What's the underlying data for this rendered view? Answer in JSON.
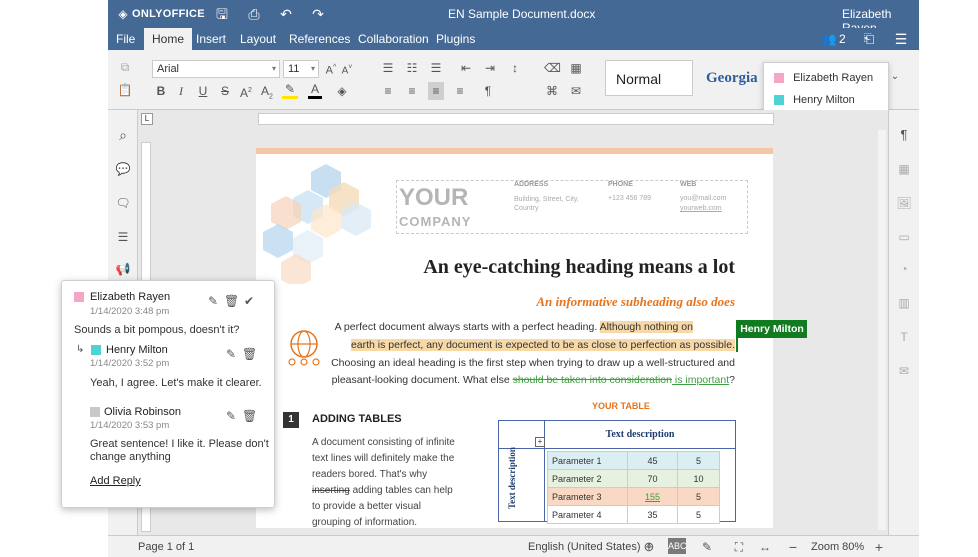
{
  "app": {
    "logo": "ONLYOFFICE",
    "doc_title": "EN Sample Document.docx",
    "user": "Elizabeth Rayen"
  },
  "menu": {
    "tabs": [
      "File",
      "Home",
      "Insert",
      "Layout",
      "References",
      "Collaboration",
      "Plugins"
    ],
    "active": "Home",
    "users_count": "2"
  },
  "toolbar": {
    "font_name": "Arial",
    "font_size": "11",
    "style_normal": "Normal",
    "style_georgia": "Georgia"
  },
  "users_popup": {
    "users": [
      {
        "name": "Elizabeth Rayen",
        "color": "#f4a6c6"
      },
      {
        "name": "Henry Milton",
        "color": "#4ed3d3"
      }
    ]
  },
  "document": {
    "logo_line1": "YOUR",
    "logo_line2": "COMPANY",
    "address_label": "ADDRESS",
    "address_value": "Building, Street, City, Country",
    "phone_label": "PHONE",
    "phone_value": "+123 456 789",
    "web_label": "WEB",
    "web_value1": "you@mail.com",
    "web_value2": "yourweb.com",
    "heading": "An eye-catching heading means a lot",
    "subheading": "An informative subheading also does",
    "para_1a": "A perfect document always starts with a perfect heading. ",
    "para_1b": "Although nothing on",
    "para_2": "earth is perfect, any document is expected to be as close to perfection as possible.",
    "para_3": "Choosing an ideal heading is the first step when trying to draw up a well-structured and",
    "para_4a": "pleasant-looking document. What else ",
    "para_4b": "should be taken into consideration",
    "para_4c": " is important",
    "para_4d": "?",
    "cursor_tag": "Henry Milton",
    "section_num": "1",
    "section_title": "ADDING TABLES",
    "body_1": "A document consisting of infinite",
    "body_2": "text lines will definitely make the",
    "body_3": "readers bored. That's why",
    "body_4a": "inserting",
    "body_4b": " adding tables can help",
    "body_5": "to provide a better visual",
    "body_6": "grouping of information.",
    "table_title": "YOUR TABLE",
    "table_header": "Text description",
    "table_side": "Text description",
    "table_rows": [
      {
        "param": "Parameter 1",
        "v1": "45",
        "v2": "5"
      },
      {
        "param": "Parameter 2",
        "v1": "70",
        "v2": "10"
      },
      {
        "param": "Parameter 3",
        "v1": "155",
        "v2": "5"
      },
      {
        "param": "Parameter 4",
        "v1": "35",
        "v2": "5"
      }
    ]
  },
  "comments": {
    "main": {
      "author": "Elizabeth Rayen",
      "date": "1/14/2020 3:48 pm",
      "text": "Sounds a bit pompous, doesn't it?",
      "color": "#f4a6c6"
    },
    "replies": [
      {
        "author": "Henry Milton",
        "date": "1/14/2020 3:52 pm",
        "text": "Yeah, I agree. Let's make it clearer.",
        "color": "#4ed3d3"
      },
      {
        "author": "Olivia Robinson",
        "date": "1/14/2020 3:53 pm",
        "text1": "Great sentence! I like it. Please don't",
        "text2": "change anything",
        "color": "#c8c8c8"
      }
    ],
    "add_reply": "Add Reply"
  },
  "status": {
    "page": "Page 1 of 1",
    "language": "English (United States)",
    "zoom": "Zoom 80%"
  },
  "colors": {
    "brand": "#446995",
    "highlight": "#f7d9a8",
    "cursor_green": "#117c1f",
    "orange": "#e7731b",
    "strike_green": "#3f9e3f"
  }
}
